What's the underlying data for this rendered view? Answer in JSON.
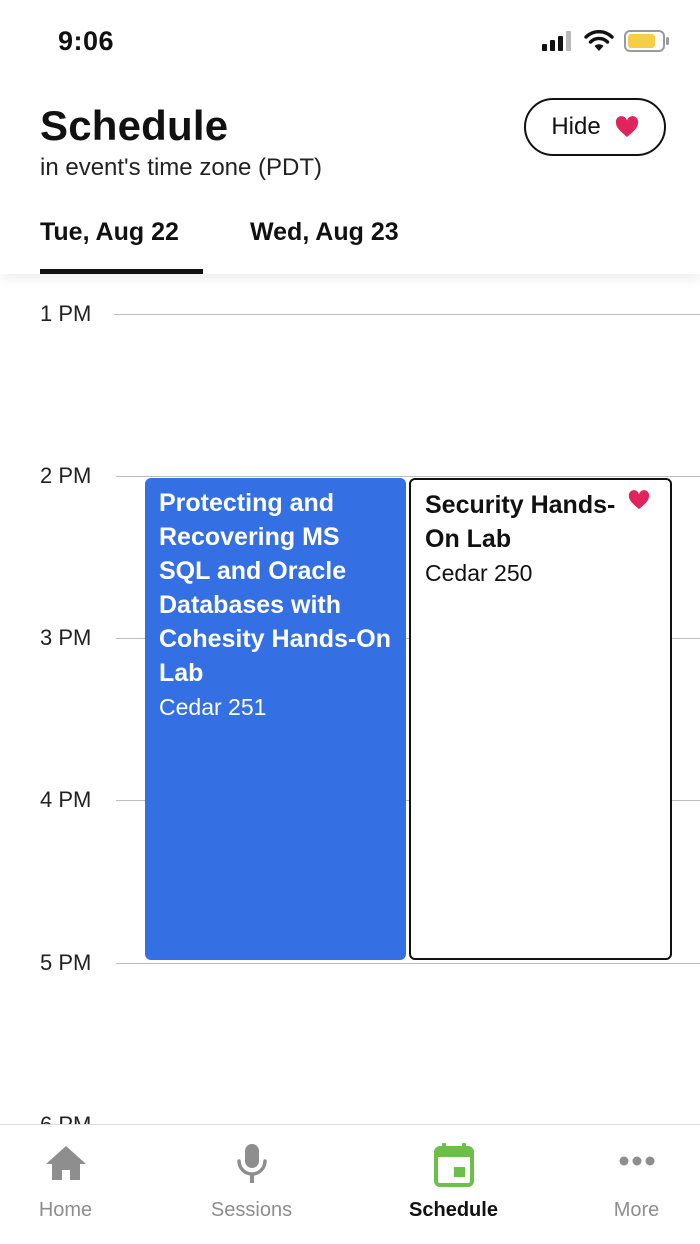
{
  "status_bar": {
    "time": "9:06"
  },
  "header": {
    "title": "Schedule",
    "subtitle": "in event's time zone (PDT)",
    "hide_button_label": "Hide"
  },
  "tabs": [
    {
      "label": "Tue, Aug 22",
      "active": true
    },
    {
      "label": "Wed, Aug 23",
      "active": false
    }
  ],
  "timeline": {
    "hours": [
      "1 PM",
      "2 PM",
      "3 PM",
      "4 PM",
      "5 PM",
      "6 PM"
    ]
  },
  "events": [
    {
      "title": "Protecting and Recovering MS SQL and Oracle Databases with Cohesity Hands-On Lab",
      "room": "Cedar 251",
      "favorited": false,
      "color": "#3470e4"
    },
    {
      "title": "Security Hands-On Lab",
      "room": "Cedar 250",
      "favorited": true,
      "color": "#ffffff"
    }
  ],
  "bottom_nav": {
    "items": [
      {
        "label": "Home",
        "icon": "home-icon",
        "active": false
      },
      {
        "label": "Sessions",
        "icon": "microphone-icon",
        "active": false
      },
      {
        "label": "Schedule",
        "icon": "calendar-icon",
        "active": true
      },
      {
        "label": "More",
        "icon": "more-dots-icon",
        "active": false
      }
    ]
  },
  "colors": {
    "accent_green": "#6cc04a",
    "event_blue": "#3470e4",
    "heart_red": "#e0245e",
    "battery_yellow": "#f5cd47"
  }
}
